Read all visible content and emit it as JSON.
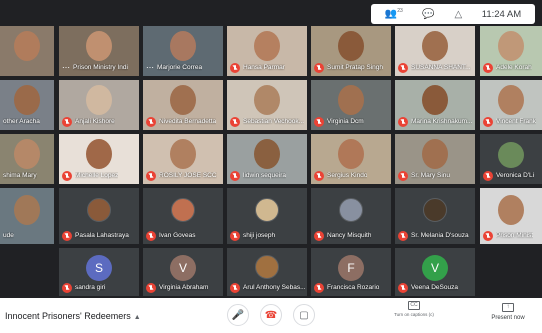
{
  "status_bar": {
    "people_count": "23",
    "time": "11:24 AM"
  },
  "meeting_title": "Innocent Prisoners' Redeemers",
  "controls": {
    "captions_icon": "CC",
    "captions_label": "Turn on captions (c)",
    "present_label": "Present now"
  },
  "rows": [
    [
      {
        "name": "",
        "muted": false,
        "bg": "#8a7a6a",
        "skin": "#b07c5c"
      },
      {
        "name": "Prison Ministry Indi",
        "muted": false,
        "dots": true,
        "bg": "#7d6e5e",
        "skin": "#c09070"
      },
      {
        "name": "Marjorie Correa",
        "muted": false,
        "dots": true,
        "bg": "#5e6a72",
        "skin": "#a87860"
      },
      {
        "name": "Hansa Parmar",
        "muted": true,
        "bg": "#c8b8a8",
        "skin": "#b58060"
      },
      {
        "name": "Sumit Pratap Singh",
        "muted": true,
        "bg": "#a89880",
        "skin": "#8a5a3a"
      },
      {
        "name": "SUSANNA SHANT...",
        "muted": true,
        "bg": "#d8d0c8",
        "skin": "#a07050"
      },
      {
        "name": "Adele Korah",
        "muted": true,
        "bg": "#b8c8b0",
        "skin": "#c09878"
      }
    ],
    [
      {
        "name": "other Aracha",
        "muted": false,
        "bg": "#7a8088",
        "skin": "#9a6a4a"
      },
      {
        "name": "Anjali Kishore",
        "muted": true,
        "bg": "#b0a8a0",
        "skin": "#d0b8a0"
      },
      {
        "name": "Nivedita Bernadetta",
        "muted": true,
        "bg": "#c0b0a0",
        "skin": "#a07050"
      },
      {
        "name": "Sebastian Vechook...",
        "muted": true,
        "bg": "#cfc5b8",
        "skin": "#b08868"
      },
      {
        "name": "Virginia Dcm",
        "muted": true,
        "bg": "#6a7070",
        "skin": "#a07050"
      },
      {
        "name": "Marina Krishnakum...",
        "muted": true,
        "bg": "#a8b0a8",
        "skin": "#8a5a3a"
      },
      {
        "name": "Vincent Frank",
        "muted": true,
        "bg": "#c0c4c0",
        "skin": "#b08060"
      }
    ],
    [
      {
        "name": "shima Mary",
        "muted": false,
        "bg": "#8a8470",
        "skin": "#b58868"
      },
      {
        "name": "Michelle Lopez",
        "muted": true,
        "bg": "#e8e0d8",
        "skin": "#a06848"
      },
      {
        "name": "ROSILY JOSE SCC",
        "muted": true,
        "bg": "#d0c0b0",
        "skin": "#b08060"
      },
      {
        "name": "lidwin sequeira",
        "muted": true,
        "bg": "#9aa0a0",
        "skin": "#8a6040"
      },
      {
        "name": "Sergius Kindo",
        "muted": true,
        "bg": "#b8a890",
        "skin": "#b07858"
      },
      {
        "name": "Sr. Mary Sinu",
        "muted": true,
        "bg": "#9a9488",
        "skin": "#a07050"
      },
      {
        "name": "Veronica D'Li",
        "muted": true,
        "bg": "#3c4043",
        "avatar": true,
        "avatar_color": "#6a8a5a",
        "avatar_text": ""
      }
    ],
    [
      {
        "name": "ude",
        "muted": false,
        "bg": "#6a7880",
        "skin": "#a07858"
      },
      {
        "name": "Pasala Lahastraya",
        "muted": true,
        "bg": "#3c4043",
        "photo": true,
        "skin": "#8a5a3a"
      },
      {
        "name": "Ivan Goveas",
        "muted": true,
        "bg": "#3c4043",
        "photo": true,
        "skin": "#c07050"
      },
      {
        "name": "shiji joseph",
        "muted": true,
        "bg": "#3c4043",
        "photo": true,
        "skin": "#d0b890"
      },
      {
        "name": "Nancy Misquith",
        "muted": true,
        "bg": "#3c4043",
        "photo": true,
        "skin": "#8890a0"
      },
      {
        "name": "Sr. Melania D'souza",
        "muted": true,
        "bg": "#3c4043",
        "photo": true,
        "skin": "#4a3a2a"
      },
      {
        "name": "Prison Minist",
        "muted": true,
        "bg": "#d8d8d8",
        "skin": "#b08060"
      }
    ],
    [
      {
        "name": "",
        "muted": false,
        "bg": "#202124",
        "empty": true
      },
      {
        "name": "sandra giri",
        "muted": true,
        "bg": "#3c4043",
        "avatar": true,
        "avatar_color": "#5c6bc0",
        "avatar_text": "S"
      },
      {
        "name": "Virginia Abraham",
        "muted": true,
        "bg": "#3c4043",
        "avatar": true,
        "avatar_color": "#8d6e63",
        "avatar_text": "V"
      },
      {
        "name": "Arul Anthony Sebas...",
        "muted": true,
        "bg": "#3c4043",
        "photo": true,
        "skin": "#a07040"
      },
      {
        "name": "Francisca Rozario",
        "muted": true,
        "bg": "#3c4043",
        "avatar": true,
        "avatar_color": "#8d6e63",
        "avatar_text": "F"
      },
      {
        "name": "Veena DeSouza",
        "muted": true,
        "bg": "#3c4043",
        "avatar": true,
        "avatar_color": "#33a04a",
        "avatar_text": "V"
      },
      {
        "name": "",
        "muted": false,
        "bg": "#202124",
        "empty": true
      }
    ]
  ]
}
